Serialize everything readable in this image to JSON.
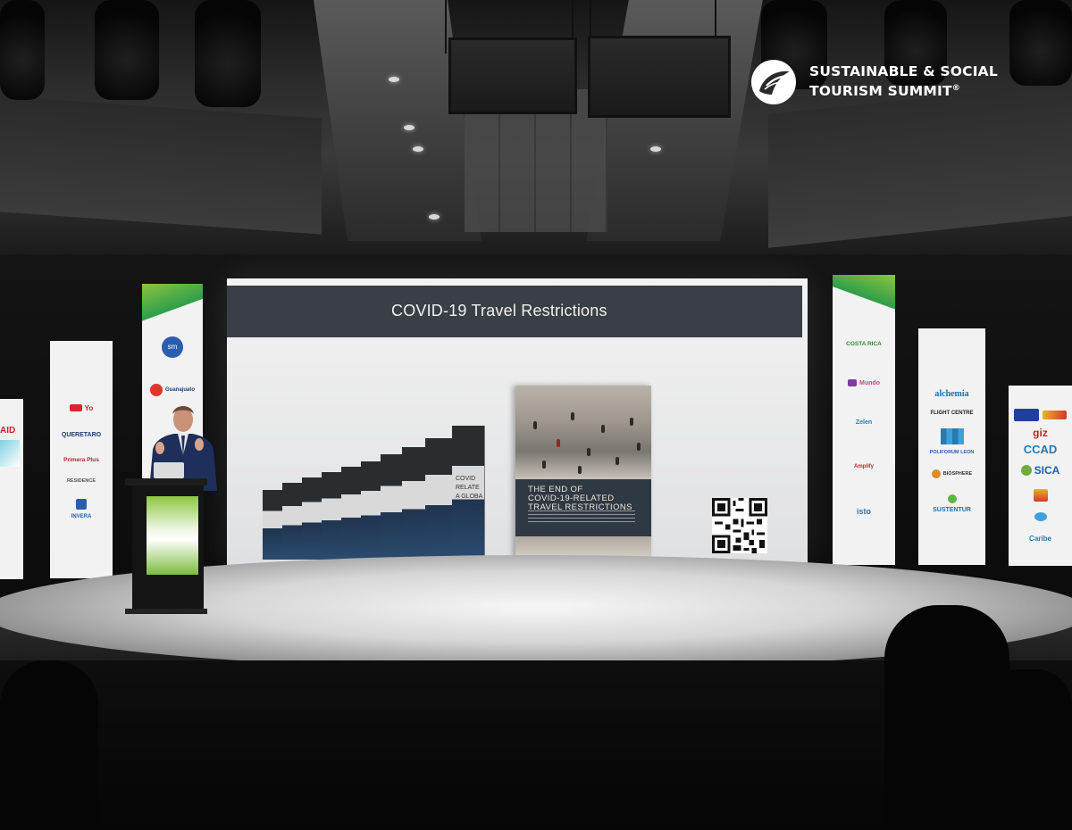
{
  "brand": {
    "line1": "SUSTAINABLE & SOCIAL",
    "line2": "TOURISM SUMMIT",
    "mark": "®",
    "colors": {
      "text": "#ffffff",
      "leaf": "#ffffff"
    }
  },
  "slide": {
    "title": "COVID-19 Travel Restrictions",
    "book_title_line1": "THE END OF",
    "book_title_line2": "COVID-19-RELATED",
    "book_title_line3": "TRAVEL RESTRICTIONS",
    "stack_label_1": "COVID",
    "stack_label_2": "RELATE",
    "stack_label_3": "A GLOBA",
    "qr_icon": "qr-code-icon",
    "colors": {
      "header": "#3a3f45",
      "background": "#eeeeee"
    }
  },
  "banners": {
    "left_outer": {
      "text": "AID"
    },
    "left_inner": {
      "logos": [
        "Yo",
        "QUERETARO",
        "Primera Plus",
        "RESIDENCE",
        "INVERA"
      ]
    },
    "left_tall": {
      "logos": [
        "sm",
        "Guanajuato"
      ]
    },
    "right_tall": {
      "logos": [
        "COSTA RICA",
        "Mundo",
        "Zelen",
        "Amplify",
        "isto"
      ]
    },
    "right_inner": {
      "logos": [
        "alchemia",
        "FLIGHT CENTRE",
        "POLIFORUM LEON",
        "BIOSPHERE",
        "SUSTENTUR"
      ]
    },
    "right_outer": {
      "logos": [
        "giz",
        "CCAD",
        "SICA",
        "Caribe"
      ]
    }
  },
  "scene": {
    "colors": {
      "brand_green": "#8bc53f",
      "dark_green": "#2e9e4a",
      "navy": "#1b3b73"
    }
  }
}
